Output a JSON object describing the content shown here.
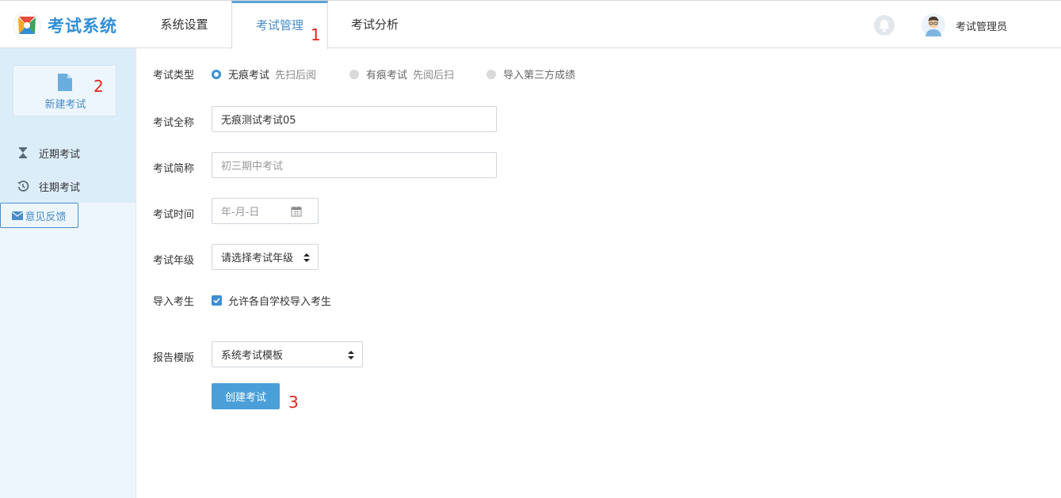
{
  "app": {
    "title": "考试系统"
  },
  "nav": {
    "tabs": [
      {
        "label": "系统设置"
      },
      {
        "label": "考试管理"
      },
      {
        "label": "考试分析"
      }
    ],
    "user_name": "考试管理员"
  },
  "sidebar": {
    "new_exam_label": "新建考试",
    "items": [
      {
        "label": "近期考试"
      },
      {
        "label": "往期考试"
      }
    ],
    "feedback_label": "意见反馈"
  },
  "form": {
    "type": {
      "label": "考试类型",
      "options": [
        {
          "label": "无痕考试",
          "sub": "先扫后阅",
          "selected": true
        },
        {
          "label": "有痕考试",
          "sub": "先阅后扫",
          "selected": false
        },
        {
          "label": "导入第三方成绩",
          "sub": "",
          "selected": false
        }
      ]
    },
    "full_name": {
      "label": "考试全称",
      "value": "无痕测试考试05"
    },
    "short_name": {
      "label": "考试简称",
      "placeholder": "初三期中考试"
    },
    "date": {
      "label": "考试时间",
      "placeholder": "年-月-日"
    },
    "grade": {
      "label": "考试年级",
      "selected": "请选择考试年级"
    },
    "import_students": {
      "label": "导入考生",
      "checkbox_label": "允许各自学校导入考生",
      "checked": true
    },
    "report_template": {
      "label": "报告模版",
      "selected": "系统考试模板"
    },
    "submit_label": "创建考试"
  },
  "annotations": [
    "1",
    "2",
    "3"
  ],
  "colors": {
    "accent": "#4a9fd8",
    "annotation": "#e1251b",
    "sidebar_bg": "#eef6fd"
  }
}
